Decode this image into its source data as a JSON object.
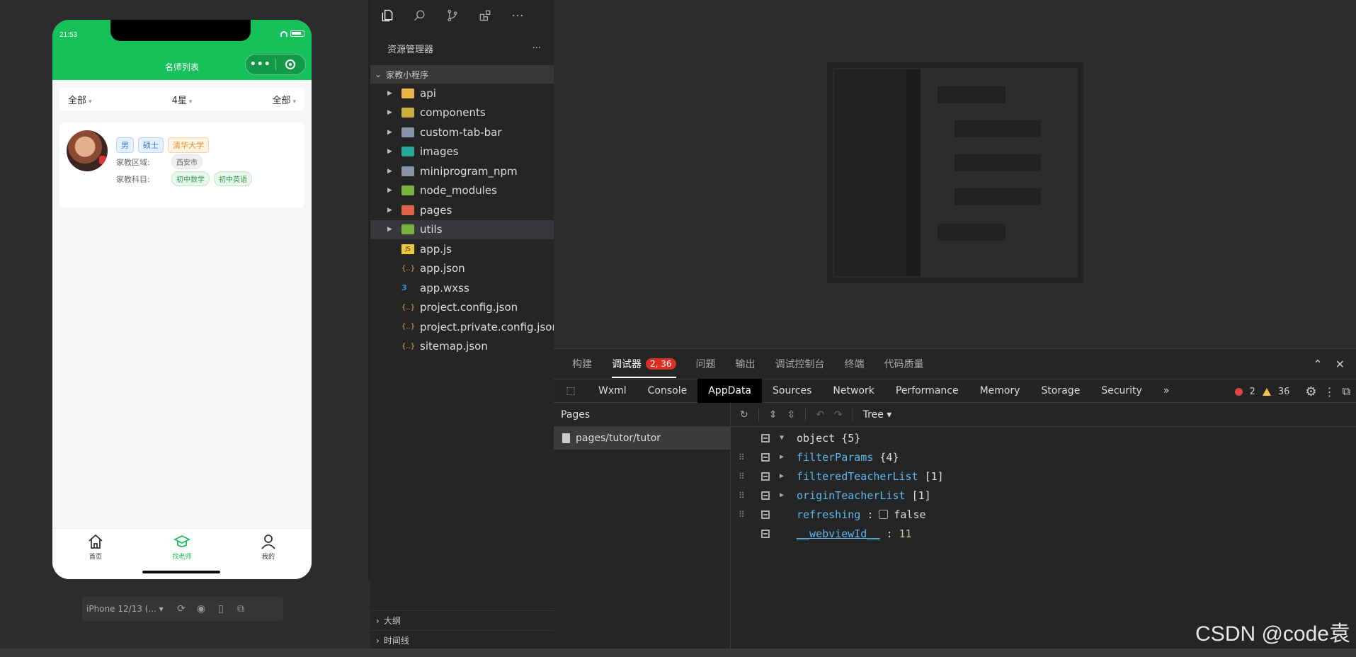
{
  "phone": {
    "time": "21:53",
    "nav_title": "名师列表",
    "capsule_dots": "•••",
    "filters": [
      "全部",
      "4星",
      "全部"
    ],
    "filter_arrow": "▾",
    "card": {
      "tags": [
        "男",
        "硕士",
        "清华大学"
      ],
      "area_label": "家教区域:",
      "area_value": "西安市",
      "subject_label": "家教科目:",
      "subjects": [
        "初中数学",
        "初中英语"
      ]
    },
    "tabs": [
      "首页",
      "找老师",
      "我的"
    ],
    "accent": "#16c15a"
  },
  "device_bar": {
    "device": "iPhone 12/13 (..."
  },
  "explorer": {
    "header": "资源管理器",
    "more": "···",
    "project": "家教小程序",
    "items": [
      {
        "name": "api",
        "type": "folder",
        "color": "#e8b64a"
      },
      {
        "name": "components",
        "type": "folder",
        "color": "#c8b03a"
      },
      {
        "name": "custom-tab-bar",
        "type": "folder",
        "color": "#8a96a8"
      },
      {
        "name": "images",
        "type": "folder",
        "color": "#2aa89a"
      },
      {
        "name": "miniprogram_npm",
        "type": "folder",
        "color": "#8a96a8"
      },
      {
        "name": "node_modules",
        "type": "folder",
        "color": "#7cb342"
      },
      {
        "name": "pages",
        "type": "folder",
        "color": "#e0614a"
      },
      {
        "name": "utils",
        "type": "folder",
        "color": "#7cb342"
      },
      {
        "name": "app.js",
        "type": "file",
        "icon": "js"
      },
      {
        "name": "app.json",
        "type": "file",
        "icon": "json"
      },
      {
        "name": "app.wxss",
        "type": "file",
        "icon": "css"
      },
      {
        "name": "project.config.json",
        "type": "file",
        "icon": "json"
      },
      {
        "name": "project.private.config.json",
        "type": "file",
        "icon": "json"
      },
      {
        "name": "sitemap.json",
        "type": "file",
        "icon": "json"
      }
    ],
    "outline": "大纲",
    "timeline": "时间线"
  },
  "debugger": {
    "tabs": [
      "构建",
      "调试器",
      "问题",
      "输出",
      "调试控制台",
      "终端",
      "代码质量"
    ],
    "badge": "2, 36",
    "devtabs": [
      "Wxml",
      "Console",
      "AppData",
      "Sources",
      "Network",
      "Performance",
      "Memory",
      "Storage",
      "Security"
    ],
    "more_tabs": "»",
    "errors": "2",
    "warnings": "36",
    "pages_head": "Pages",
    "page_item": "pages/tutor/tutor",
    "view_mode": "Tree",
    "tree": {
      "root": "object",
      "root_count": "{5}",
      "rows": [
        {
          "key": "filterParams",
          "val": "{4}"
        },
        {
          "key": "filteredTeacherList",
          "val": "[1]"
        },
        {
          "key": "originTeacherList",
          "val": "[1]"
        },
        {
          "key": "refreshing",
          "val": "false"
        },
        {
          "key": "__webviewId__",
          "val": "11"
        }
      ],
      "colon": ":"
    }
  },
  "watermark": "CSDN @code袁"
}
